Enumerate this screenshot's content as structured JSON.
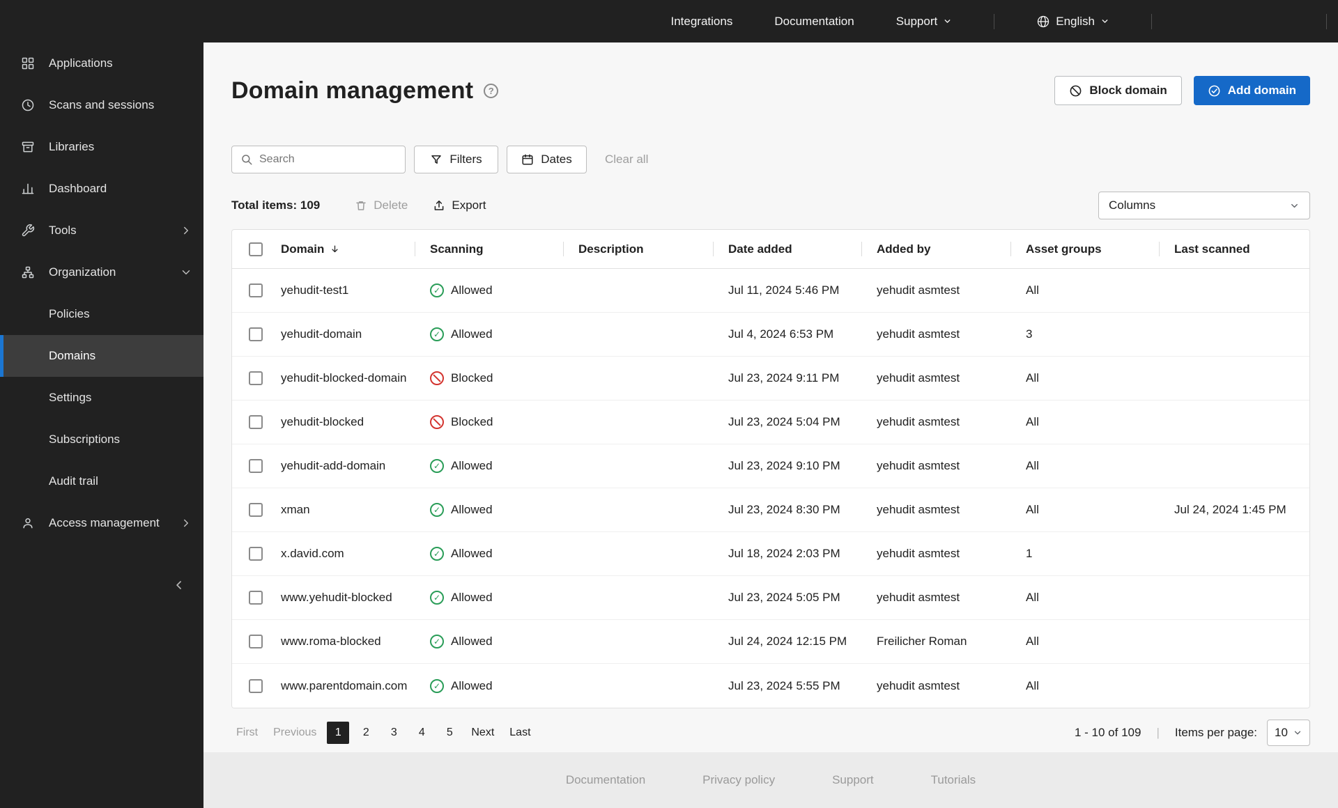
{
  "colors": {
    "accent_blue": "#1569c8",
    "active_border_blue": "#1b76d2",
    "allowed_green": "#2a9d58",
    "blocked_red": "#d3342f",
    "dark_bg": "#212121"
  },
  "topbar": {
    "integrations": "Integrations",
    "documentation": "Documentation",
    "support": "Support",
    "language": "English"
  },
  "sidebar": {
    "applications": "Applications",
    "scans_and_sessions": "Scans and sessions",
    "libraries": "Libraries",
    "dashboard": "Dashboard",
    "tools": "Tools",
    "organization": "Organization",
    "policies": "Policies",
    "domains": "Domains",
    "settings": "Settings",
    "subscriptions": "Subscriptions",
    "audit_trail": "Audit trail",
    "access_management": "Access management"
  },
  "header": {
    "title": "Domain management",
    "block_domain": "Block domain",
    "add_domain": "Add domain"
  },
  "toolbar": {
    "search_placeholder": "Search",
    "filters": "Filters",
    "dates": "Dates",
    "clear_all": "Clear all",
    "total_items": "Total items: 109",
    "delete": "Delete",
    "export": "Export",
    "columns": "Columns"
  },
  "table": {
    "headers": [
      "Domain",
      "Scanning",
      "Description",
      "Date added",
      "Added by",
      "Asset groups",
      "Last scanned"
    ],
    "rows": [
      {
        "domain": "yehudit-test1",
        "scanning": "Allowed",
        "status": "allowed",
        "description": "",
        "date_added": "Jul 11, 2024 5:46 PM",
        "added_by": "yehudit asmtest",
        "asset_groups": "All",
        "last_scanned": ""
      },
      {
        "domain": "yehudit-domain",
        "scanning": "Allowed",
        "status": "allowed",
        "description": "",
        "date_added": "Jul 4, 2024 6:53 PM",
        "added_by": "yehudit asmtest",
        "asset_groups": "3",
        "last_scanned": ""
      },
      {
        "domain": "yehudit-blocked-domain",
        "scanning": "Blocked",
        "status": "blocked",
        "description": "",
        "date_added": "Jul 23, 2024 9:11 PM",
        "added_by": "yehudit asmtest",
        "asset_groups": "All",
        "last_scanned": ""
      },
      {
        "domain": "yehudit-blocked",
        "scanning": "Blocked",
        "status": "blocked",
        "description": "",
        "date_added": "Jul 23, 2024 5:04 PM",
        "added_by": "yehudit asmtest",
        "asset_groups": "All",
        "last_scanned": ""
      },
      {
        "domain": "yehudit-add-domain",
        "scanning": "Allowed",
        "status": "allowed",
        "description": "",
        "date_added": "Jul 23, 2024 9:10 PM",
        "added_by": "yehudit asmtest",
        "asset_groups": "All",
        "last_scanned": ""
      },
      {
        "domain": "xman",
        "scanning": "Allowed",
        "status": "allowed",
        "description": "",
        "date_added": "Jul 23, 2024 8:30 PM",
        "added_by": "yehudit asmtest",
        "asset_groups": "All",
        "last_scanned": "Jul 24, 2024 1:45 PM"
      },
      {
        "domain": "x.david.com",
        "scanning": "Allowed",
        "status": "allowed",
        "description": "",
        "date_added": "Jul 18, 2024 2:03 PM",
        "added_by": "yehudit asmtest",
        "asset_groups": "1",
        "last_scanned": ""
      },
      {
        "domain": "www.yehudit-blocked",
        "scanning": "Allowed",
        "status": "allowed",
        "description": "",
        "date_added": "Jul 23, 2024 5:05 PM",
        "added_by": "yehudit asmtest",
        "asset_groups": "All",
        "last_scanned": ""
      },
      {
        "domain": "www.roma-blocked",
        "scanning": "Allowed",
        "status": "allowed",
        "description": "",
        "date_added": "Jul 24, 2024 12:15 PM",
        "added_by": "Freilicher Roman",
        "asset_groups": "All",
        "last_scanned": ""
      },
      {
        "domain": "www.parentdomain.com",
        "scanning": "Allowed",
        "status": "allowed",
        "description": "",
        "date_added": "Jul 23, 2024 5:55 PM",
        "added_by": "yehudit asmtest",
        "asset_groups": "All",
        "last_scanned": ""
      }
    ]
  },
  "pagination": {
    "first": "First",
    "previous": "Previous",
    "pages": [
      "1",
      "2",
      "3",
      "4",
      "5"
    ],
    "next": "Next",
    "last": "Last",
    "range": "1 - 10 of 109",
    "separator": "|",
    "items_per_page_label": "Items per page:",
    "items_per_page_value": "10"
  },
  "footer": {
    "documentation": "Documentation",
    "privacy_policy": "Privacy policy",
    "support": "Support",
    "tutorials": "Tutorials"
  },
  "icons": {
    "search-icon": "magnifier",
    "filters-icon": "funnel",
    "dates-icon": "calendar",
    "delete-icon": "trash-can",
    "export-icon": "upload-arrow",
    "block-icon": "circle-slash",
    "add-check-icon": "circle-check",
    "help-icon": "circle-question-mark",
    "globe-icon": "globe",
    "sort-desc-icon": "arrow-down",
    "allowed-icon": "green-circle-check",
    "blocked-icon": "red-circle-slash",
    "chevron-down-icon": "chevron-down",
    "chevron-right-icon": "chevron-right",
    "collapse-icon": "chevron-left"
  }
}
